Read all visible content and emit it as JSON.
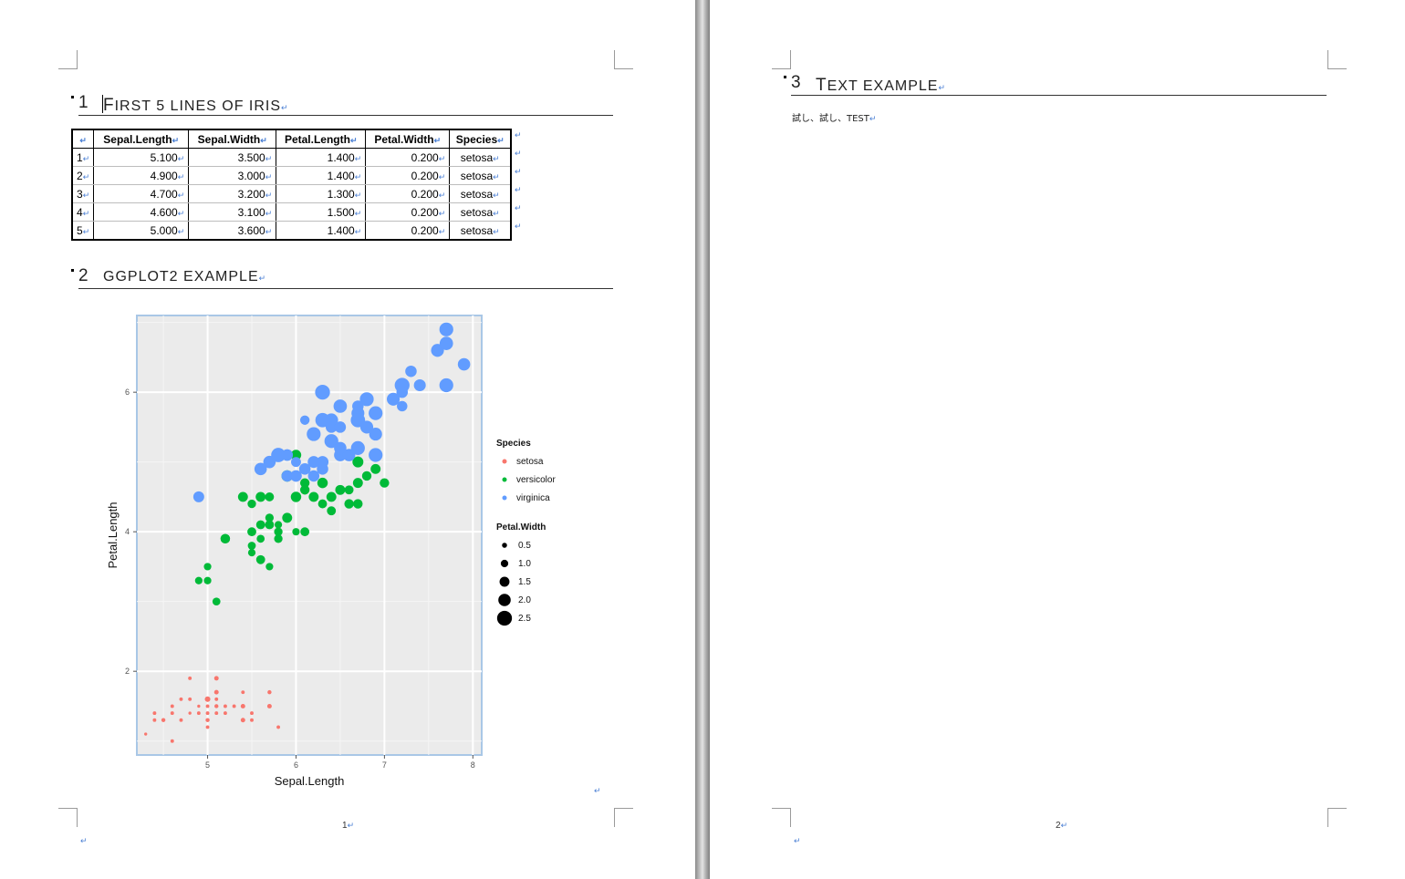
{
  "page1": {
    "heading1": {
      "number": "1",
      "first_letter": "F",
      "rest": "IRST 5 LINES OF IRIS"
    },
    "table": {
      "headers": [
        "",
        "Sepal.Length",
        "Sepal.Width",
        "Petal.Length",
        "Petal.Width",
        "Species"
      ],
      "rows": [
        [
          "1",
          "5.100",
          "3.500",
          "1.400",
          "0.200",
          "setosa"
        ],
        [
          "2",
          "4.900",
          "3.000",
          "1.400",
          "0.200",
          "setosa"
        ],
        [
          "3",
          "4.700",
          "3.200",
          "1.300",
          "0.200",
          "setosa"
        ],
        [
          "4",
          "4.600",
          "3.100",
          "1.500",
          "0.200",
          "setosa"
        ],
        [
          "5",
          "5.000",
          "3.600",
          "1.400",
          "0.200",
          "setosa"
        ]
      ]
    },
    "heading2": {
      "number": "2",
      "title": "GGPLOT2 EXAMPLE"
    },
    "page_number": "1"
  },
  "page2": {
    "heading3": {
      "number": "3",
      "first_letter": "T",
      "rest": "EXT EXAMPLE"
    },
    "body": "試し、試し、TEST",
    "page_number": "2"
  },
  "colors": {
    "setosa": "#f8766d",
    "versicolor": "#00ba38",
    "virginica": "#619cff",
    "panel": "#ebebeb",
    "grid": "#ffffff"
  },
  "chart_data": {
    "type": "scatter",
    "xlabel": "Sepal.Length",
    "ylabel": "Petal.Length",
    "xlim": [
      4.2,
      8.1
    ],
    "ylim": [
      0.8,
      7.1
    ],
    "x_ticks": [
      5,
      6,
      7,
      8
    ],
    "y_ticks": [
      2,
      4,
      6
    ],
    "legend_position": "right",
    "legend_color_title": "Species",
    "legend_size_title": "Petal.Width",
    "size_breaks": [
      "0.5",
      "1.0",
      "1.5",
      "2.0",
      "2.5"
    ],
    "series": [
      {
        "name": "setosa",
        "points": [
          [
            4.3,
            1.1,
            0.1
          ],
          [
            4.4,
            1.4,
            0.2
          ],
          [
            4.4,
            1.3,
            0.2
          ],
          [
            4.5,
            1.3,
            0.3
          ],
          [
            4.6,
            1.4,
            0.2
          ],
          [
            4.6,
            1.5,
            0.2
          ],
          [
            4.6,
            1.0,
            0.2
          ],
          [
            4.7,
            1.3,
            0.2
          ],
          [
            4.7,
            1.6,
            0.2
          ],
          [
            4.8,
            1.6,
            0.2
          ],
          [
            4.8,
            1.4,
            0.1
          ],
          [
            4.8,
            1.9,
            0.2
          ],
          [
            4.9,
            1.4,
            0.2
          ],
          [
            4.9,
            1.5,
            0.1
          ],
          [
            5.0,
            1.4,
            0.2
          ],
          [
            5.0,
            1.5,
            0.2
          ],
          [
            5.0,
            1.6,
            0.6
          ],
          [
            5.0,
            1.2,
            0.2
          ],
          [
            5.0,
            1.3,
            0.3
          ],
          [
            5.1,
            1.4,
            0.2
          ],
          [
            5.1,
            1.5,
            0.3
          ],
          [
            5.1,
            1.7,
            0.4
          ],
          [
            5.1,
            1.9,
            0.4
          ],
          [
            5.1,
            1.6,
            0.2
          ],
          [
            5.2,
            1.5,
            0.2
          ],
          [
            5.2,
            1.4,
            0.2
          ],
          [
            5.3,
            1.5,
            0.2
          ],
          [
            5.4,
            1.7,
            0.2
          ],
          [
            5.4,
            1.5,
            0.4
          ],
          [
            5.4,
            1.3,
            0.4
          ],
          [
            5.5,
            1.4,
            0.2
          ],
          [
            5.5,
            1.3,
            0.2
          ],
          [
            5.7,
            1.5,
            0.4
          ],
          [
            5.7,
            1.7,
            0.3
          ],
          [
            5.8,
            1.2,
            0.2
          ]
        ]
      },
      {
        "name": "versicolor",
        "points": [
          [
            7.0,
            4.7,
            1.4
          ],
          [
            6.4,
            4.5,
            1.5
          ],
          [
            6.9,
            4.9,
            1.5
          ],
          [
            5.5,
            4.0,
            1.3
          ],
          [
            6.5,
            4.6,
            1.5
          ],
          [
            5.7,
            4.5,
            1.3
          ],
          [
            6.3,
            4.7,
            1.6
          ],
          [
            4.9,
            3.3,
            1.0
          ],
          [
            6.6,
            4.6,
            1.3
          ],
          [
            5.2,
            3.9,
            1.4
          ],
          [
            5.0,
            3.5,
            1.0
          ],
          [
            5.9,
            4.2,
            1.5
          ],
          [
            6.0,
            4.0,
            1.0
          ],
          [
            6.1,
            4.7,
            1.4
          ],
          [
            5.6,
            3.6,
            1.3
          ],
          [
            6.7,
            4.4,
            1.4
          ],
          [
            5.6,
            4.5,
            1.5
          ],
          [
            5.8,
            4.1,
            1.0
          ],
          [
            6.2,
            4.5,
            1.5
          ],
          [
            5.6,
            3.9,
            1.1
          ],
          [
            5.9,
            4.8,
            1.8
          ],
          [
            6.1,
            4.0,
            1.3
          ],
          [
            6.3,
            4.9,
            1.5
          ],
          [
            6.1,
            4.7,
            1.2
          ],
          [
            6.4,
            4.3,
            1.3
          ],
          [
            6.6,
            4.4,
            1.4
          ],
          [
            6.8,
            4.8,
            1.4
          ],
          [
            6.7,
            5.0,
            1.7
          ],
          [
            6.0,
            4.5,
            1.5
          ],
          [
            5.7,
            3.5,
            1.0
          ],
          [
            5.5,
            3.8,
            1.1
          ],
          [
            5.5,
            3.7,
            1.0
          ],
          [
            5.8,
            3.9,
            1.2
          ],
          [
            6.0,
            5.1,
            1.6
          ],
          [
            5.4,
            4.5,
            1.5
          ],
          [
            6.0,
            4.5,
            1.6
          ],
          [
            6.7,
            4.7,
            1.5
          ],
          [
            6.3,
            4.4,
            1.3
          ],
          [
            5.6,
            4.1,
            1.3
          ],
          [
            5.5,
            4.4,
            1.2
          ],
          [
            6.1,
            4.6,
            1.4
          ],
          [
            5.8,
            4.0,
            1.2
          ],
          [
            5.0,
            3.3,
            1.0
          ],
          [
            5.7,
            4.2,
            1.2
          ],
          [
            5.2,
            3.9,
            1.4
          ],
          [
            5.1,
            3.0,
            1.1
          ],
          [
            5.7,
            4.1,
            1.3
          ]
        ]
      },
      {
        "name": "virginica",
        "points": [
          [
            6.3,
            6.0,
            2.5
          ],
          [
            5.8,
            5.1,
            1.9
          ],
          [
            7.1,
            5.9,
            2.1
          ],
          [
            6.3,
            5.6,
            1.8
          ],
          [
            6.5,
            5.8,
            2.2
          ],
          [
            7.6,
            6.6,
            2.1
          ],
          [
            4.9,
            4.5,
            1.7
          ],
          [
            7.3,
            6.3,
            1.8
          ],
          [
            6.7,
            5.8,
            1.8
          ],
          [
            7.2,
            6.1,
            2.5
          ],
          [
            6.5,
            5.1,
            2.0
          ],
          [
            6.4,
            5.3,
            1.9
          ],
          [
            6.8,
            5.5,
            2.1
          ],
          [
            5.7,
            5.0,
            2.0
          ],
          [
            5.8,
            5.1,
            2.4
          ],
          [
            6.4,
            5.3,
            2.3
          ],
          [
            7.7,
            6.7,
            2.2
          ],
          [
            7.7,
            6.9,
            2.3
          ],
          [
            6.0,
            5.0,
            1.5
          ],
          [
            6.9,
            5.7,
            2.3
          ],
          [
            5.6,
            4.9,
            2.0
          ],
          [
            6.3,
            4.9,
            1.8
          ],
          [
            6.7,
            5.7,
            2.1
          ],
          [
            7.2,
            6.0,
            1.8
          ],
          [
            6.2,
            4.8,
            1.8
          ],
          [
            6.1,
            4.9,
            1.8
          ],
          [
            7.2,
            5.8,
            1.6
          ],
          [
            7.4,
            6.1,
            1.9
          ],
          [
            7.9,
            6.4,
            2.0
          ],
          [
            6.4,
            5.6,
            2.2
          ],
          [
            6.1,
            5.6,
            1.4
          ],
          [
            7.7,
            6.1,
            2.3
          ],
          [
            6.3,
            5.6,
            2.4
          ],
          [
            6.4,
            5.5,
            1.8
          ],
          [
            6.0,
            4.8,
            1.8
          ],
          [
            6.9,
            5.4,
            2.1
          ],
          [
            6.7,
            5.6,
            2.4
          ],
          [
            6.9,
            5.1,
            2.3
          ],
          [
            6.8,
            5.9,
            2.3
          ],
          [
            6.7,
            5.2,
            2.3
          ],
          [
            6.3,
            5.0,
            1.9
          ],
          [
            6.5,
            5.2,
            2.0
          ],
          [
            6.2,
            5.4,
            2.3
          ],
          [
            5.9,
            5.1,
            1.8
          ],
          [
            6.5,
            5.5,
            1.8
          ],
          [
            6.0,
            4.8,
            1.8
          ],
          [
            5.9,
            4.8,
            1.8
          ],
          [
            6.2,
            5.0,
            1.9
          ],
          [
            5.9,
            5.1,
            1.8
          ],
          [
            6.6,
            5.1,
            2.0
          ]
        ]
      }
    ]
  }
}
